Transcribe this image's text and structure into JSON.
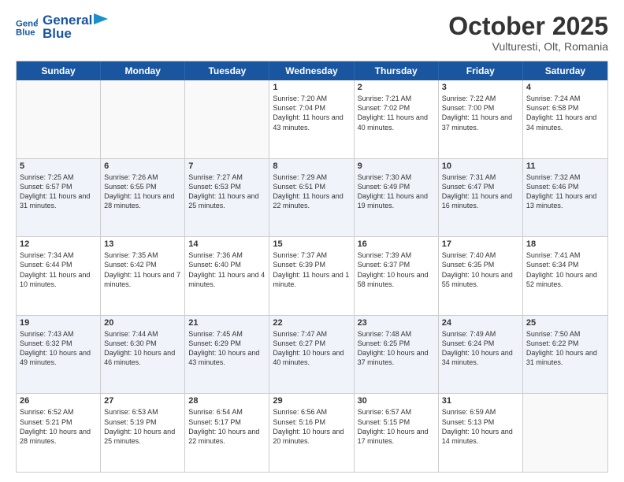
{
  "header": {
    "logo_line1": "General",
    "logo_line2": "Blue",
    "month": "October 2025",
    "location": "Vulturesti, Olt, Romania"
  },
  "weekdays": [
    "Sunday",
    "Monday",
    "Tuesday",
    "Wednesday",
    "Thursday",
    "Friday",
    "Saturday"
  ],
  "rows": [
    [
      {
        "day": "",
        "text": ""
      },
      {
        "day": "",
        "text": ""
      },
      {
        "day": "",
        "text": ""
      },
      {
        "day": "1",
        "text": "Sunrise: 7:20 AM\nSunset: 7:04 PM\nDaylight: 11 hours and 43 minutes."
      },
      {
        "day": "2",
        "text": "Sunrise: 7:21 AM\nSunset: 7:02 PM\nDaylight: 11 hours and 40 minutes."
      },
      {
        "day": "3",
        "text": "Sunrise: 7:22 AM\nSunset: 7:00 PM\nDaylight: 11 hours and 37 minutes."
      },
      {
        "day": "4",
        "text": "Sunrise: 7:24 AM\nSunset: 6:58 PM\nDaylight: 11 hours and 34 minutes."
      }
    ],
    [
      {
        "day": "5",
        "text": "Sunrise: 7:25 AM\nSunset: 6:57 PM\nDaylight: 11 hours and 31 minutes."
      },
      {
        "day": "6",
        "text": "Sunrise: 7:26 AM\nSunset: 6:55 PM\nDaylight: 11 hours and 28 minutes."
      },
      {
        "day": "7",
        "text": "Sunrise: 7:27 AM\nSunset: 6:53 PM\nDaylight: 11 hours and 25 minutes."
      },
      {
        "day": "8",
        "text": "Sunrise: 7:29 AM\nSunset: 6:51 PM\nDaylight: 11 hours and 22 minutes."
      },
      {
        "day": "9",
        "text": "Sunrise: 7:30 AM\nSunset: 6:49 PM\nDaylight: 11 hours and 19 minutes."
      },
      {
        "day": "10",
        "text": "Sunrise: 7:31 AM\nSunset: 6:47 PM\nDaylight: 11 hours and 16 minutes."
      },
      {
        "day": "11",
        "text": "Sunrise: 7:32 AM\nSunset: 6:46 PM\nDaylight: 11 hours and 13 minutes."
      }
    ],
    [
      {
        "day": "12",
        "text": "Sunrise: 7:34 AM\nSunset: 6:44 PM\nDaylight: 11 hours and 10 minutes."
      },
      {
        "day": "13",
        "text": "Sunrise: 7:35 AM\nSunset: 6:42 PM\nDaylight: 11 hours and 7 minutes."
      },
      {
        "day": "14",
        "text": "Sunrise: 7:36 AM\nSunset: 6:40 PM\nDaylight: 11 hours and 4 minutes."
      },
      {
        "day": "15",
        "text": "Sunrise: 7:37 AM\nSunset: 6:39 PM\nDaylight: 11 hours and 1 minute."
      },
      {
        "day": "16",
        "text": "Sunrise: 7:39 AM\nSunset: 6:37 PM\nDaylight: 10 hours and 58 minutes."
      },
      {
        "day": "17",
        "text": "Sunrise: 7:40 AM\nSunset: 6:35 PM\nDaylight: 10 hours and 55 minutes."
      },
      {
        "day": "18",
        "text": "Sunrise: 7:41 AM\nSunset: 6:34 PM\nDaylight: 10 hours and 52 minutes."
      }
    ],
    [
      {
        "day": "19",
        "text": "Sunrise: 7:43 AM\nSunset: 6:32 PM\nDaylight: 10 hours and 49 minutes."
      },
      {
        "day": "20",
        "text": "Sunrise: 7:44 AM\nSunset: 6:30 PM\nDaylight: 10 hours and 46 minutes."
      },
      {
        "day": "21",
        "text": "Sunrise: 7:45 AM\nSunset: 6:29 PM\nDaylight: 10 hours and 43 minutes."
      },
      {
        "day": "22",
        "text": "Sunrise: 7:47 AM\nSunset: 6:27 PM\nDaylight: 10 hours and 40 minutes."
      },
      {
        "day": "23",
        "text": "Sunrise: 7:48 AM\nSunset: 6:25 PM\nDaylight: 10 hours and 37 minutes."
      },
      {
        "day": "24",
        "text": "Sunrise: 7:49 AM\nSunset: 6:24 PM\nDaylight: 10 hours and 34 minutes."
      },
      {
        "day": "25",
        "text": "Sunrise: 7:50 AM\nSunset: 6:22 PM\nDaylight: 10 hours and 31 minutes."
      }
    ],
    [
      {
        "day": "26",
        "text": "Sunrise: 6:52 AM\nSunset: 5:21 PM\nDaylight: 10 hours and 28 minutes."
      },
      {
        "day": "27",
        "text": "Sunrise: 6:53 AM\nSunset: 5:19 PM\nDaylight: 10 hours and 25 minutes."
      },
      {
        "day": "28",
        "text": "Sunrise: 6:54 AM\nSunset: 5:17 PM\nDaylight: 10 hours and 22 minutes."
      },
      {
        "day": "29",
        "text": "Sunrise: 6:56 AM\nSunset: 5:16 PM\nDaylight: 10 hours and 20 minutes."
      },
      {
        "day": "30",
        "text": "Sunrise: 6:57 AM\nSunset: 5:15 PM\nDaylight: 10 hours and 17 minutes."
      },
      {
        "day": "31",
        "text": "Sunrise: 6:59 AM\nSunset: 5:13 PM\nDaylight: 10 hours and 14 minutes."
      },
      {
        "day": "",
        "text": ""
      }
    ]
  ]
}
